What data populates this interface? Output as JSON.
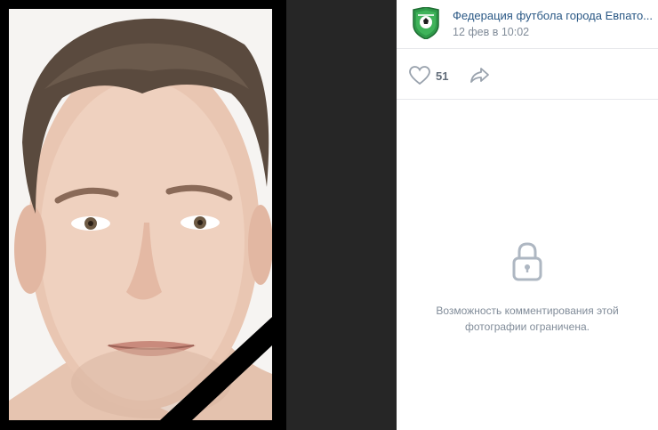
{
  "post": {
    "owner_name": "Федерация футбола города Евпато...",
    "date": "12 фев в 10:02"
  },
  "actions": {
    "likes_count": "51"
  },
  "comments": {
    "closed_line1": "Возможность комментирования этой",
    "closed_line2": "фотографии ограничена."
  },
  "colors": {
    "link": "#2a5885",
    "muted": "#818c99",
    "icon": "#99a2ad",
    "logo_green": "#2f9a4a"
  },
  "icons": {
    "avatar": "federation-logo-icon",
    "like": "heart-icon",
    "share": "share-arrow-icon",
    "lock": "lock-icon"
  }
}
